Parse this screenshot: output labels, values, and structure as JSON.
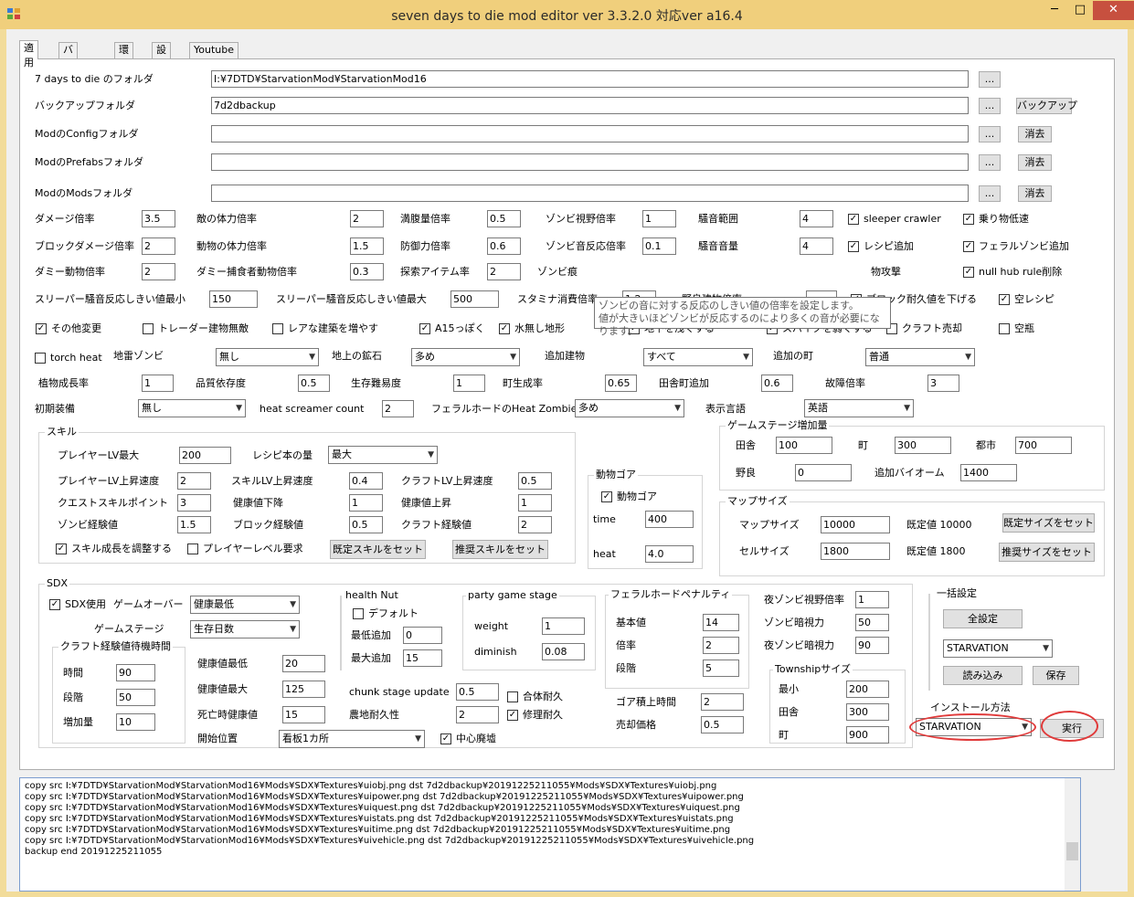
{
  "window": {
    "title": "seven days to die mod editor ver 3.3.2.0 対応ver a16.4",
    "min": "─",
    "max": "□",
    "close": "✕"
  },
  "tabs": [
    "適用",
    "バックアップ",
    "環境",
    "設定",
    "Youtube"
  ],
  "folders": {
    "game_label": "7 days to die のフォルダ",
    "game_value": "I:¥7DTD¥StarvationMod¥StarvationMod16",
    "backup_label": "バックアップフォルダ",
    "backup_value": "7d2dbackup",
    "config_label": "ModのConfigフォルダ",
    "prefabs_label": "ModのPrefabsフォルダ",
    "mods_label": "ModのModsフォルダ",
    "browse": "...",
    "backup_btn": "バックアップ",
    "clear_btn": "消去"
  },
  "row1": {
    "damage": "ダメージ倍率",
    "damage_v": "3.5",
    "enemy_hp": "敵の体力倍率",
    "enemy_hp_v": "2",
    "hunger": "満腹量倍率",
    "hunger_v": "0.5",
    "zombie_sight": "ゾンビ視野倍率",
    "zombie_sight_v": "1",
    "noise_range": "騒音範囲",
    "noise_range_v": "4",
    "sleeper_crawler": "sleeper crawler",
    "vehicle_slow": "乗り物低速"
  },
  "row2": {
    "block_damage": "ブロックダメージ倍率",
    "block_damage_v": "2",
    "animal_hp": "動物の体力倍率",
    "animal_hp_v": "1.5",
    "defense": "防御力倍率",
    "defense_v": "0.6",
    "zombie_sound": "ゾンビ音反応倍率",
    "zombie_sound_v": "0.1",
    "noise_vol": "騒音音量",
    "noise_vol_v": "4",
    "recipe_add": "レシピ追加",
    "feral_add": "フェラルゾンビ追加"
  },
  "row3": {
    "dummy_animal": "ダミー動物倍率",
    "dummy_animal_v": "2",
    "dummy_predator": "ダミー捕食者動物倍率",
    "dummy_predator_v": "0.3",
    "explore": "探索アイテム率",
    "explore_v": "2",
    "zombie_prefix": "ゾンビ痕",
    "animal_attack": "物攻撃",
    "null_hub": "null hub rule削除"
  },
  "tooltip": {
    "line1": "ゾンビの音に対する反応のしきい値の倍率を設定します。",
    "line2": "値が大きいほどゾンビが反応するのにより多くの音が必要になります。"
  },
  "row4": {
    "sleeper_min": "スリーパー騒音反応しきい値最小",
    "sleeper_min_v": "150",
    "sleeper_max": "スリーパー騒音反応しきい値最大",
    "sleeper_max_v": "500",
    "stamina": "スタミナ消費倍率",
    "stamina_v": "1.2",
    "wild_animal": "野良建物倍率",
    "block_dur": "ブロック耐久値を下げる",
    "empty_recipe": "空レシピ"
  },
  "row5": {
    "other": "その他変更",
    "trader": "トレーダー建物無敵",
    "rare": "レアな建築を増やす",
    "a15": "A15っぽく",
    "waterless": "水無し地形",
    "underground": "地下を浅くする",
    "spike": "スパイクを弱くする",
    "craft_sell": "クラフト売却",
    "empty_bottle": "空瓶"
  },
  "row6": {
    "torch_heat": "torch heat",
    "landmine": "地雷ゾンビ",
    "landmine_v": "無し",
    "ore": "地上の鉱石",
    "ore_v": "多め",
    "add_building": "追加建物",
    "add_building_v": "すべて",
    "add_town": "追加の町",
    "add_town_v": "普通"
  },
  "row7": {
    "plant": "植物成長率",
    "plant_v": "1",
    "quality": "品質依存度",
    "quality_v": "0.5",
    "survival": "生存難易度",
    "survival_v": "1",
    "town_gen": "町生成率",
    "town_gen_v": "0.65",
    "rural_add": "田舎町追加",
    "rural_add_v": "0.6",
    "failure": "故障倍率",
    "failure_v": "3"
  },
  "row8": {
    "initial": "初期装備",
    "initial_v": "無し",
    "screamer": "heat screamer count",
    "screamer_v": "2",
    "feral_heat": "フェラルホードのHeat Zombie量",
    "feral_heat_v": "多め",
    "language": "表示言語",
    "language_v": "英語"
  },
  "skill": {
    "title": "スキル",
    "player_lv_max": "プレイヤーLV最大",
    "player_lv_max_v": "200",
    "recipe_books": "レシピ本の量",
    "recipe_books_v": "最大",
    "player_lv_speed": "プレイヤーLV上昇速度",
    "player_lv_speed_v": "2",
    "skill_lv_speed": "スキルLV上昇速度",
    "skill_lv_speed_v": "0.4",
    "craft_lv_speed": "クラフトLV上昇速度",
    "craft_lv_speed_v": "0.5",
    "quest_points": "クエストスキルポイント",
    "quest_points_v": "3",
    "health_down": "健康値下降",
    "health_down_v": "1",
    "health_up": "健康値上昇",
    "health_up_v": "1",
    "zombie_exp": "ゾンビ経験値",
    "zombie_exp_v": "1.5",
    "block_exp": "ブロック経験値",
    "block_exp_v": "0.5",
    "craft_exp": "クラフト経験値",
    "craft_exp_v": "2",
    "adjust_growth": "スキル成長を調整する",
    "player_level_req": "プレイヤーレベル要求",
    "set_default": "既定スキルをセット",
    "set_recommended": "推奨スキルをセット"
  },
  "gore": {
    "title": "動物ゴア",
    "check": "動物ゴア",
    "time": "time",
    "time_v": "400",
    "heat": "heat",
    "heat_v": "4.0"
  },
  "gamestage": {
    "title": "ゲームステージ増加量",
    "rural": "田舎",
    "rural_v": "100",
    "town": "町",
    "town_v": "300",
    "city": "都市",
    "city_v": "700",
    "wild": "野良",
    "wild_v": "0",
    "biome": "追加バイオーム",
    "biome_v": "1400"
  },
  "mapsize": {
    "title": "マップサイズ",
    "map": "マップサイズ",
    "map_v": "10000",
    "map_def": "既定値 10000",
    "map_btn": "既定サイズをセット",
    "cell": "セルサイズ",
    "cell_v": "1800",
    "cell_def": "既定値 1800",
    "cell_btn": "推奨サイズをセット"
  },
  "sdx": {
    "title": "SDX",
    "use": "SDX使用",
    "gameover": "ゲームオーバー",
    "gameover_v": "健康最低",
    "gamestage": "ゲームステージ",
    "gamestage_v": "生存日数",
    "craft_title": "クラフト経験値待機時間",
    "time": "時間",
    "time_v": "90",
    "steps": "段階",
    "steps_v": "50",
    "increase": "増加量",
    "increase_v": "10",
    "health_min": "健康値最低",
    "health_min_v": "20",
    "health_max": "健康値最大",
    "health_max_v": "125",
    "death_health": "死亡時健康値",
    "death_health_v": "15",
    "start_pos": "開始位置",
    "start_pos_v": "看板1カ所",
    "center_ruins": "中心廃墟"
  },
  "health_nut": {
    "title": "health Nut",
    "default": "デフォルト",
    "min_add": "最低追加",
    "min_add_v": "0",
    "max_add": "最大追加",
    "max_add_v": "15"
  },
  "party": {
    "title": "party game stage",
    "weight": "weight",
    "weight_v": "1",
    "diminish": "diminish",
    "diminish_v": "0.08"
  },
  "chunk": {
    "update": "chunk stage update",
    "update_v": "0.5",
    "farm": "農地耐久性",
    "farm_v": "2",
    "merge_dur": "合体耐久",
    "repair_dur": "修理耐久"
  },
  "feral": {
    "title": "フェラルホードペナルティ",
    "base": "基本値",
    "base_v": "14",
    "rate": "倍率",
    "rate_v": "2",
    "steps": "段階",
    "steps_v": "5",
    "gore_time": "ゴア積上時間",
    "gore_time_v": "2",
    "sell_price": "売却価格",
    "sell_price_v": "0.5"
  },
  "night": {
    "sight": "夜ゾンビ視野倍率",
    "sight_v": "1",
    "dark_sight": "ゾンビ暗視力",
    "dark_sight_v": "50",
    "night_dark": "夜ゾンビ暗視力",
    "night_dark_v": "90"
  },
  "township": {
    "title": "Townshipサイズ",
    "min": "最小",
    "min_v": "200",
    "rural": "田舎",
    "rural_v": "300",
    "town": "町",
    "town_v": "900"
  },
  "bulk": {
    "title": "一括設定",
    "all": "全設定",
    "preset": "STARVATION",
    "load": "読み込み",
    "save": "保存"
  },
  "install": {
    "label": "インストール方法",
    "method": "STARVATION",
    "run": "実行"
  },
  "log": [
    "copy src I:¥7DTD¥StarvationMod¥StarvationMod16¥Mods¥SDX¥Textures¥uiobj.png dst 7d2dbackup¥20191225211055¥Mods¥SDX¥Textures¥uiobj.png",
    "copy src I:¥7DTD¥StarvationMod¥StarvationMod16¥Mods¥SDX¥Textures¥uipower.png dst 7d2dbackup¥20191225211055¥Mods¥SDX¥Textures¥uipower.png",
    "copy src I:¥7DTD¥StarvationMod¥StarvationMod16¥Mods¥SDX¥Textures¥uiquest.png dst 7d2dbackup¥20191225211055¥Mods¥SDX¥Textures¥uiquest.png",
    "copy src I:¥7DTD¥StarvationMod¥StarvationMod16¥Mods¥SDX¥Textures¥uistats.png dst 7d2dbackup¥20191225211055¥Mods¥SDX¥Textures¥uistats.png",
    "copy src I:¥7DTD¥StarvationMod¥StarvationMod16¥Mods¥SDX¥Textures¥uitime.png dst 7d2dbackup¥20191225211055¥Mods¥SDX¥Textures¥uitime.png",
    "copy src I:¥7DTD¥StarvationMod¥StarvationMod16¥Mods¥SDX¥Textures¥uivehicle.png dst 7d2dbackup¥20191225211055¥Mods¥SDX¥Textures¥uivehicle.png",
    "backup end 20191225211055"
  ],
  "icons": {
    "check": "✓",
    "arrow": "▼",
    "app": "app-icon"
  },
  "colors": {
    "title_bar": "#f0cf7c",
    "close_button": "#c7503f",
    "highlight_ring": "#e03a3a"
  }
}
